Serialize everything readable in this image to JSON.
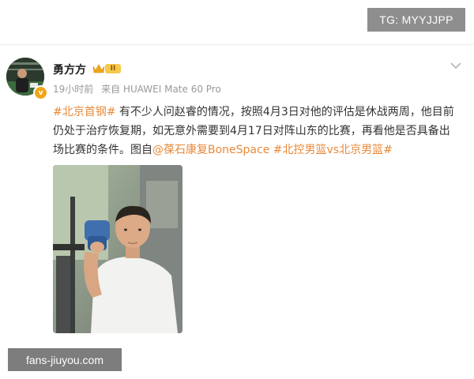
{
  "overlay": {
    "tg_label": "TG: MYYJJPP",
    "site_watermark": "fans-jiuyou.com"
  },
  "post": {
    "author": "勇方方",
    "level": "II",
    "avatar_badge": "v",
    "time": "19小时前",
    "source": "来自 HUAWEI Mate 60 Pro",
    "text": {
      "tag1": "#北京首钢#",
      "body": " 有不少人问赵睿的情况，按照4月3日对他的评估是休战两周，他目前仍处于治疗恢复期，如无意外需要到4月17日对阵山东的比赛，再看他是否具备出场比赛的条件。图自",
      "mention": "@葆石康复BoneSpace",
      "space": " ",
      "tag2": "#北控男篮vs北京男篮#"
    }
  },
  "colors": {
    "tag": "#e8893a",
    "meta": "#999999",
    "watermark_bg": "#7d7d7d"
  }
}
